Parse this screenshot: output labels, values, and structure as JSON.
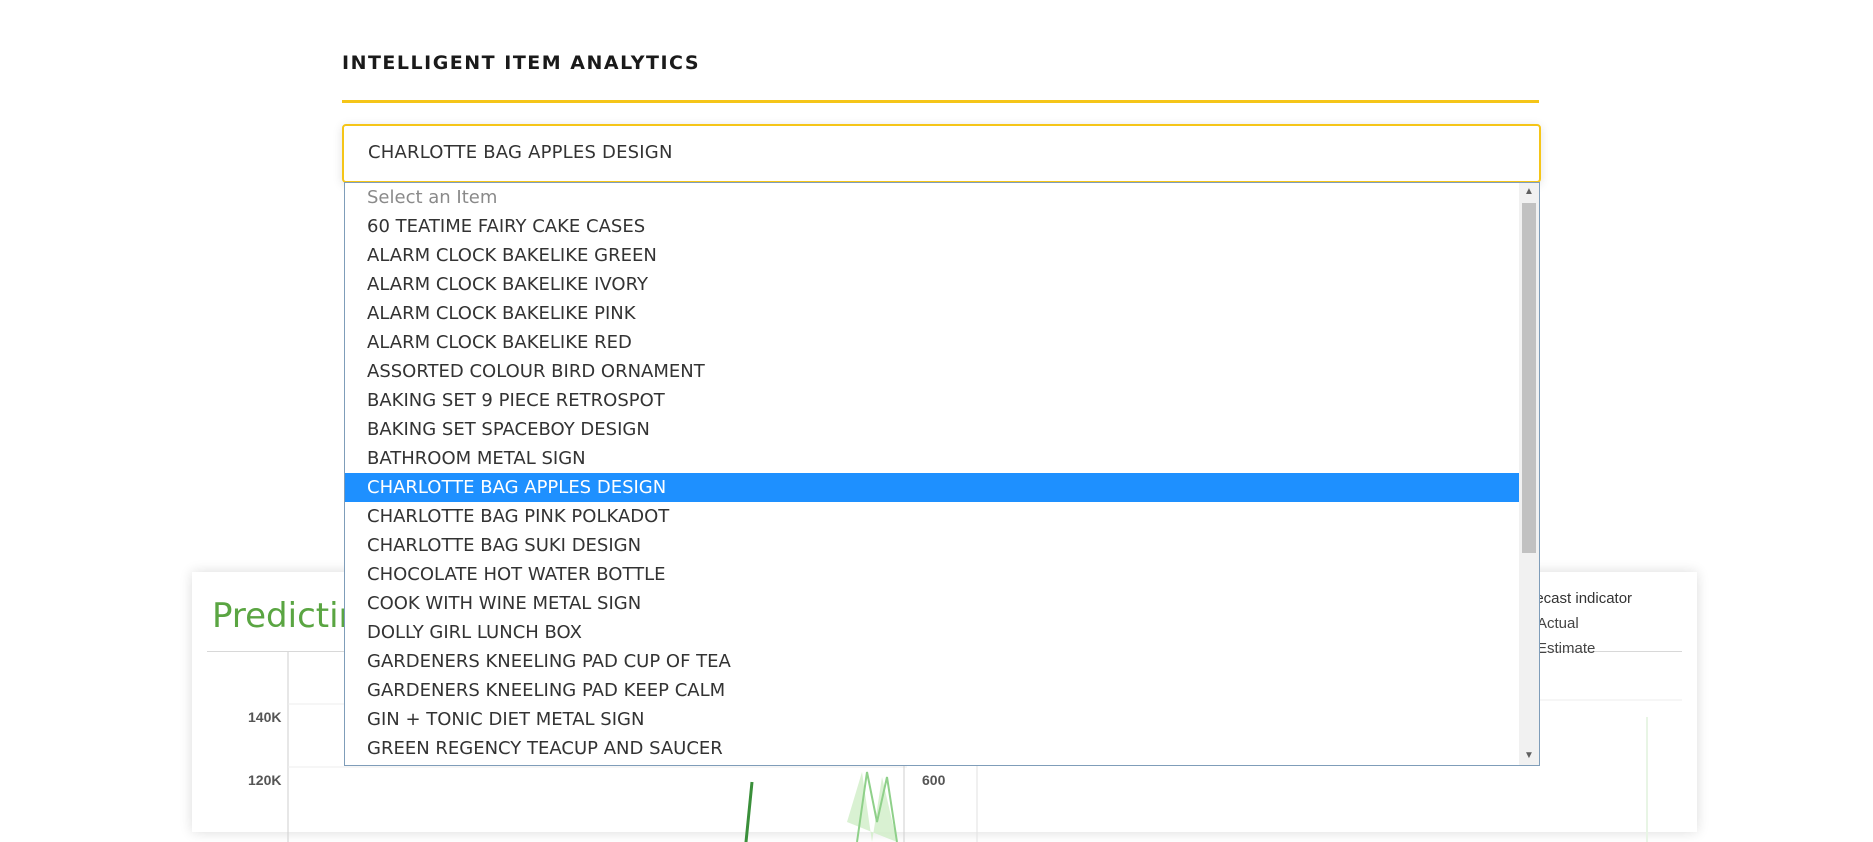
{
  "header": {
    "title": "INTELLIGENT ITEM ANALYTICS"
  },
  "select": {
    "value": "CHARLOTTE BAG APPLES DESIGN"
  },
  "dropdown": {
    "options": [
      {
        "label": "Select an Item",
        "state": "placeholder"
      },
      {
        "label": "60 TEATIME FAIRY CAKE CASES"
      },
      {
        "label": "ALARM CLOCK BAKELIKE GREEN"
      },
      {
        "label": "ALARM CLOCK BAKELIKE IVORY"
      },
      {
        "label": "ALARM CLOCK BAKELIKE PINK"
      },
      {
        "label": "ALARM CLOCK BAKELIKE RED"
      },
      {
        "label": "ASSORTED COLOUR BIRD ORNAMENT"
      },
      {
        "label": "BAKING SET 9 PIECE RETROSPOT"
      },
      {
        "label": "BAKING SET SPACEBOY DESIGN"
      },
      {
        "label": "BATHROOM METAL SIGN"
      },
      {
        "label": "CHARLOTTE BAG APPLES DESIGN",
        "state": "selected"
      },
      {
        "label": "CHARLOTTE BAG PINK POLKADOT"
      },
      {
        "label": "CHARLOTTE BAG SUKI DESIGN"
      },
      {
        "label": "CHOCOLATE HOT WATER BOTTLE"
      },
      {
        "label": "COOK WITH WINE METAL SIGN"
      },
      {
        "label": "DOLLY GIRL LUNCH BOX"
      },
      {
        "label": "GARDENERS KNEELING PAD CUP OF TEA"
      },
      {
        "label": "GARDENERS KNEELING PAD KEEP CALM"
      },
      {
        "label": "GIN + TONIC DIET METAL SIGN"
      },
      {
        "label": "GREEN REGENCY TEACUP AND SAUCER"
      }
    ],
    "scroll_fraction": 0.0,
    "up_arrow": "▲",
    "down_arrow": "▼"
  },
  "card": {
    "title": "Predicting",
    "y_ticks": [
      "140K",
      "120K"
    ],
    "right_tick": "600",
    "legend": {
      "title": "orecast indicator",
      "items": [
        {
          "label": "Actual",
          "color": "#3a8f3a"
        },
        {
          "label": "Estimate",
          "color": "#a8dca0"
        }
      ]
    }
  },
  "colors": {
    "accent": "#f5c518",
    "selected": "#1e90ff",
    "chart_green": "#5aa542"
  }
}
